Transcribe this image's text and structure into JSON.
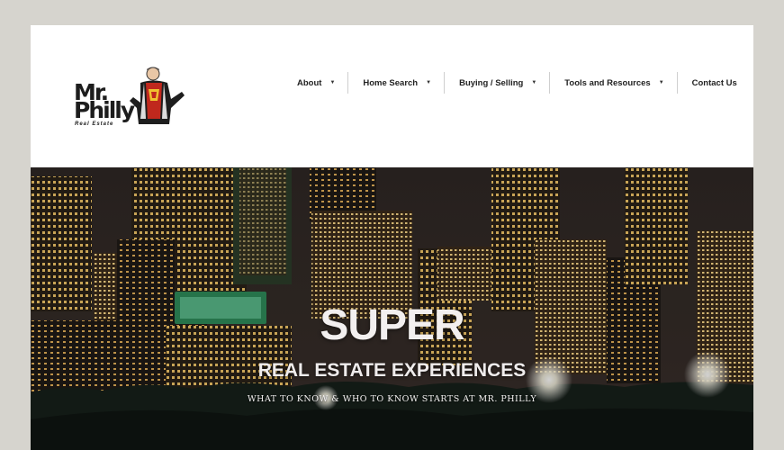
{
  "logo": {
    "line1": "Mr.",
    "line2": "Philly",
    "tagline": "Real Estate"
  },
  "nav": [
    {
      "label": "About",
      "dropdown": true
    },
    {
      "label": "Home Search",
      "dropdown": true
    },
    {
      "label": "Buying / Selling",
      "dropdown": true
    },
    {
      "label": "Tools and Resources",
      "dropdown": true
    },
    {
      "label": "Contact Us",
      "dropdown": false
    }
  ],
  "hero": {
    "title": "SUPER",
    "subtitle": "REAL ESTATE EXPERIENCES",
    "tagline": "WHAT TO KNOW & WHO TO KNOW STARTS AT MR. PHILLY",
    "image": "philadelphia-skyline-night"
  },
  "colors": {
    "page_bg": "#d6d4ce",
    "header_bg": "#ffffff",
    "nav_text": "#222222",
    "logo_red": "#c0281d"
  }
}
